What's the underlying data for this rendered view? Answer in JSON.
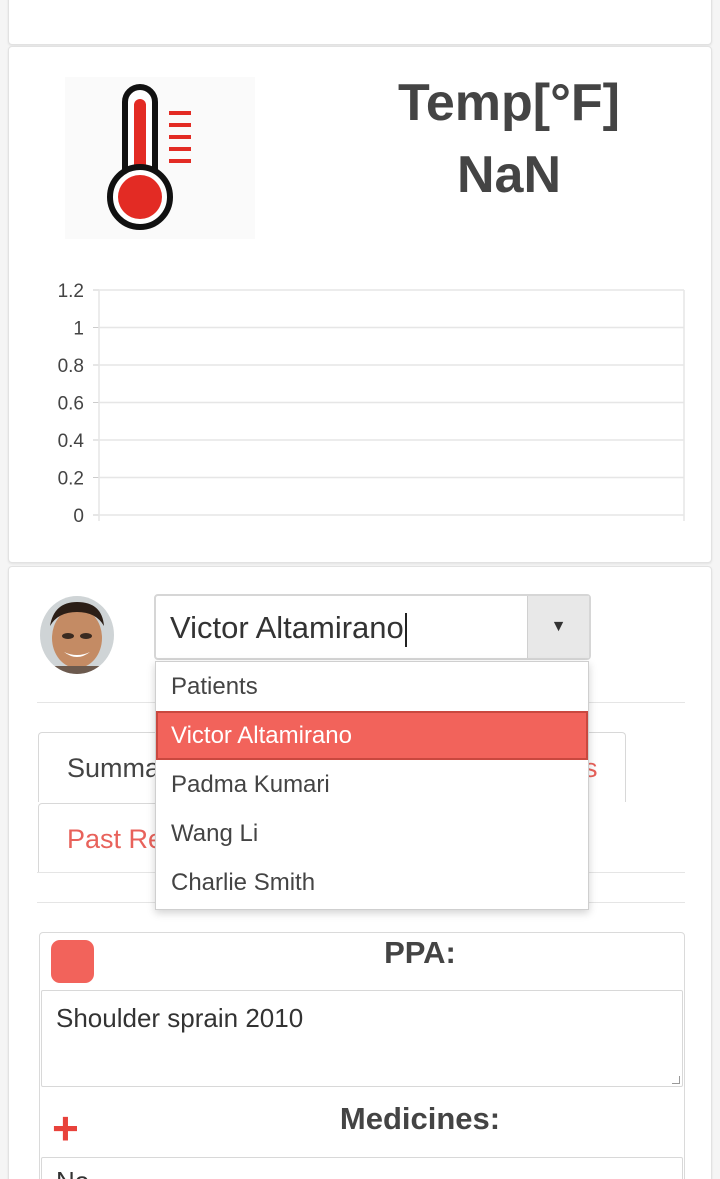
{
  "temperature": {
    "title": "Temp[°F]",
    "value": "NaN",
    "icon": "thermometer-icon",
    "colors": {
      "thermo_red": "#e32b24"
    }
  },
  "chart_data": {
    "type": "line",
    "title": "",
    "xlabel": "",
    "ylabel": "",
    "ylim": [
      0,
      1.2
    ],
    "yticks": [
      "1.2",
      "1",
      "0.8",
      "0.6",
      "0.4",
      "0.2",
      "0"
    ],
    "series": []
  },
  "patient": {
    "selected": "Victor Altamirano",
    "dropdown_options": [
      "Patients",
      "Victor Altamirano",
      "Padma Kumari",
      "Wang Li",
      "Charlie Smith"
    ],
    "selected_index": 1,
    "accent": "#f2635b"
  },
  "tabs": {
    "summary_fragment": "Summa",
    "summary_right_fragment": "s",
    "past_fragment": "Past Re"
  },
  "records": {
    "ppa_label": "PPA:",
    "ppa_text": "Shoulder sprain 2010",
    "medicines_label": "Medicines:",
    "medicines_text": "No"
  }
}
